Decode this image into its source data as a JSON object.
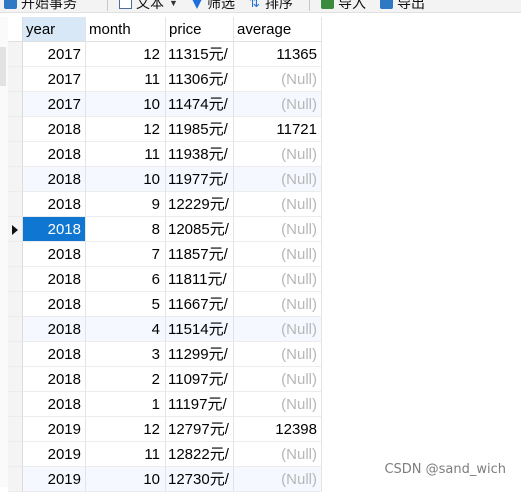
{
  "toolbar": {
    "begin_label": "开始事务",
    "text_label": "文本",
    "filter_label": "筛选",
    "sort_label": "排序",
    "import_label": "导入",
    "export_label": "导出"
  },
  "table": {
    "columns": [
      "year",
      "month",
      "price",
      "average"
    ],
    "rows": [
      {
        "year": "2017",
        "month": "12",
        "price": "11315元/",
        "average": "11365"
      },
      {
        "year": "2017",
        "month": "11",
        "price": "11306元/",
        "average": "(Null)"
      },
      {
        "year": "2017",
        "month": "10",
        "price": "11474元/",
        "average": "(Null)"
      },
      {
        "year": "2018",
        "month": "12",
        "price": "11985元/",
        "average": "11721"
      },
      {
        "year": "2018",
        "month": "11",
        "price": "11938元/",
        "average": "(Null)"
      },
      {
        "year": "2018",
        "month": "10",
        "price": "11977元/",
        "average": "(Null)"
      },
      {
        "year": "2018",
        "month": "9",
        "price": "12229元/",
        "average": "(Null)"
      },
      {
        "year": "2018",
        "month": "8",
        "price": "12085元/",
        "average": "(Null)"
      },
      {
        "year": "2018",
        "month": "7",
        "price": "11857元/",
        "average": "(Null)"
      },
      {
        "year": "2018",
        "month": "6",
        "price": "11811元/",
        "average": "(Null)"
      },
      {
        "year": "2018",
        "month": "5",
        "price": "11667元/",
        "average": "(Null)"
      },
      {
        "year": "2018",
        "month": "4",
        "price": "11514元/",
        "average": "(Null)"
      },
      {
        "year": "2018",
        "month": "3",
        "price": "11299元/",
        "average": "(Null)"
      },
      {
        "year": "2018",
        "month": "2",
        "price": "11097元/",
        "average": "(Null)"
      },
      {
        "year": "2018",
        "month": "1",
        "price": "11197元/",
        "average": "(Null)"
      },
      {
        "year": "2019",
        "month": "12",
        "price": "12797元/",
        "average": "12398"
      },
      {
        "year": "2019",
        "month": "11",
        "price": "12822元/",
        "average": "(Null)"
      },
      {
        "year": "2019",
        "month": "10",
        "price": "12730元/",
        "average": "(Null)"
      }
    ],
    "selected_row": 7,
    "alt_rows": [
      2,
      5,
      11,
      17
    ]
  },
  "colors": {
    "selection": "#0f77d1",
    "null_text": "#b7b7b7",
    "header_highlight": "#d8e8f7"
  },
  "watermark": "CSDN @sand_wich"
}
